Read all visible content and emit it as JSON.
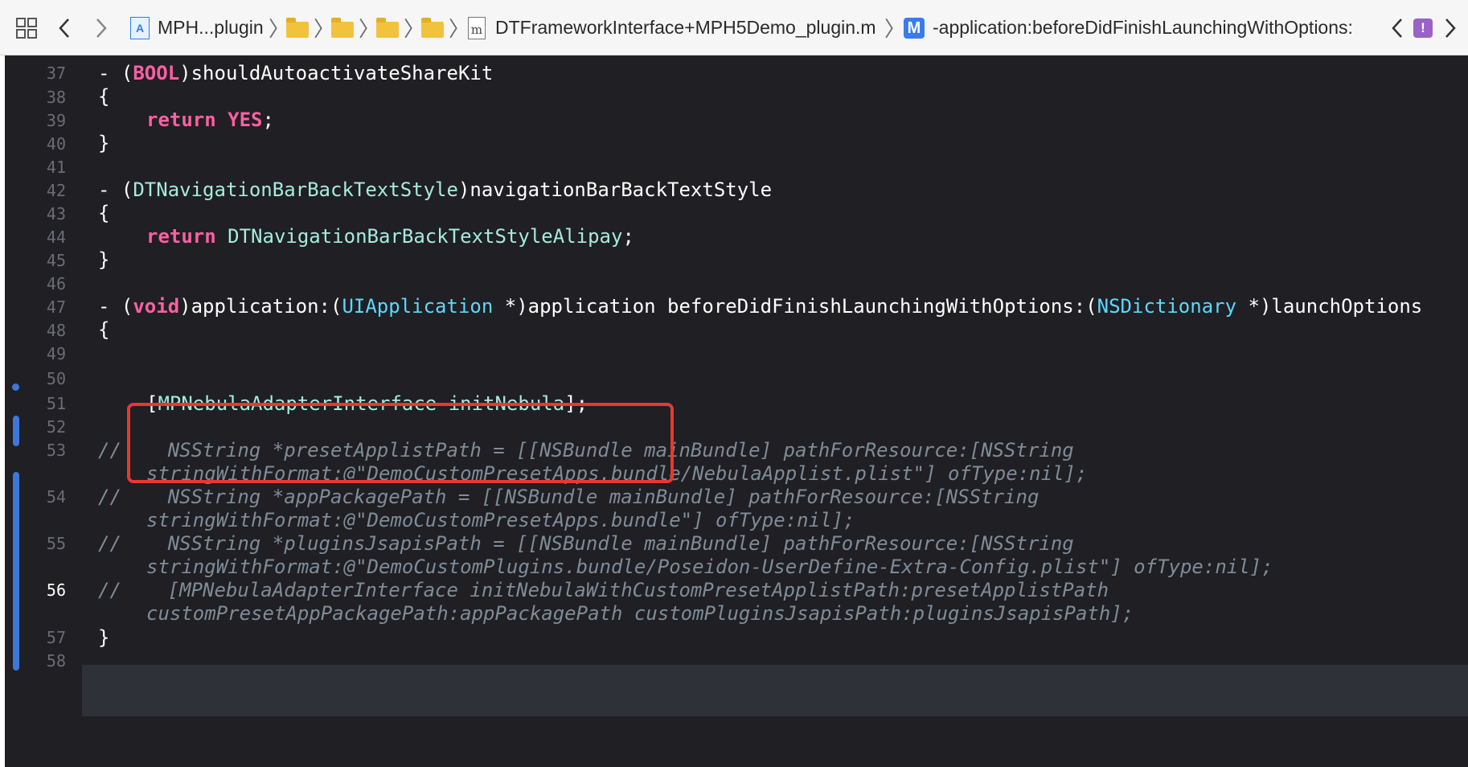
{
  "jumpbar": {
    "project": "MPH...plugin",
    "file": "DTFrameworkInterface+MPH5Demo_plugin.m",
    "file_icon_letter": "m",
    "method_icon_letter": "M",
    "method": "-application:beforeDidFinishLaunchingWithOptions:",
    "warning_icon_letter": "!"
  },
  "line_numbers": [
    "37",
    "38",
    "39",
    "40",
    "41",
    "42",
    "43",
    "44",
    "45",
    "46",
    "47",
    "48",
    "49",
    "50",
    "51",
    "52",
    "53",
    "54",
    "55",
    "56",
    "57",
    "58"
  ],
  "current_line": "56",
  "code": {
    "l37": {
      "a": "- (",
      "b": "BOOL",
      "c": ")shouldAutoactivateShareKit"
    },
    "l38": "{",
    "l39": {
      "kw": "return",
      "val": "YES",
      "end": ";"
    },
    "l40": "}",
    "l42": {
      "a": "- (",
      "b": "DTNavigationBarBackTextStyle",
      "c": ")navigationBarBackTextStyle"
    },
    "l43": "{",
    "l44": {
      "kw": "return",
      "val": "DTNavigationBarBackTextStyleAlipay",
      "end": ";"
    },
    "l45": "}",
    "l47": {
      "a": "- (",
      "b": "void",
      "c": ")application:(",
      "d": "UIApplication",
      "e": " *)application beforeDidFinishLaunchingWithOptions:(",
      "f": "NSDictionary",
      "g": " *)launchOptions"
    },
    "l48": "{",
    "l51": {
      "open": "[",
      "cls": "MPNebulaAdapterInterface",
      "sp": " ",
      "method": "initNebula",
      "close": "];"
    },
    "l53a": "//    NSString *presetApplistPath = [[NSBundle mainBundle] pathForResource:[NSString",
    "l53b": "stringWithFormat:@\"DemoCustomPresetApps.bundle/NebulaApplist.plist\"] ofType:nil];",
    "l54a": "//    NSString *appPackagePath = [[NSBundle mainBundle] pathForResource:[NSString",
    "l54b": "stringWithFormat:@\"DemoCustomPresetApps.bundle\"] ofType:nil];",
    "l55a": "//    NSString *pluginsJsapisPath = [[NSBundle mainBundle] pathForResource:[NSString",
    "l55b": "stringWithFormat:@\"DemoCustomPlugins.bundle/Poseidon-UserDefine-Extra-Config.plist\"] ofType:nil];",
    "l56a": "//    [MPNebulaAdapterInterface initNebulaWithCustomPresetApplistPath:presetApplistPath",
    "l56b": "customPresetAppPackagePath:appPackagePath customPluginsJsapisPath:pluginsJsapisPath];",
    "l57": "}"
  }
}
